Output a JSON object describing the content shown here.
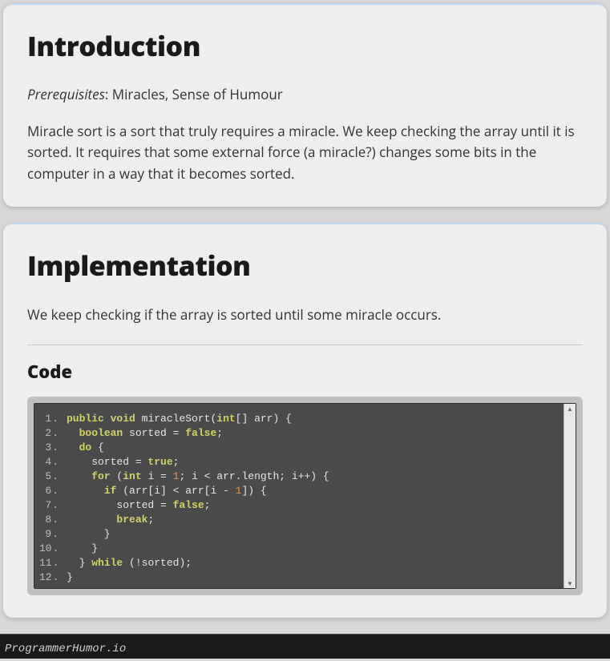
{
  "section1": {
    "heading": "Introduction",
    "prereq_label": "Prerequisites",
    "prereq_value": ": Miracles, Sense of Humour",
    "body": "Miracle sort is a sort that truly requires a miracle. We keep checking the array until it is sorted. It requires that some external force (a miracle?) changes some bits in the computer in a way that it becomes sorted."
  },
  "section2": {
    "heading": "Implementation",
    "body": "We keep checking if the array is sorted until some miracle occurs.",
    "code_heading": "Code",
    "code": [
      [
        {
          "t": "public",
          "c": "kw"
        },
        {
          "t": " "
        },
        {
          "t": "void",
          "c": "kw"
        },
        {
          "t": " miracleSort("
        },
        {
          "t": "int",
          "c": "type"
        },
        {
          "t": "[] arr) {"
        }
      ],
      [
        {
          "t": "  "
        },
        {
          "t": "boolean",
          "c": "type"
        },
        {
          "t": " sorted = "
        },
        {
          "t": "false",
          "c": "lit"
        },
        {
          "t": ";"
        }
      ],
      [
        {
          "t": "  "
        },
        {
          "t": "do",
          "c": "kw"
        },
        {
          "t": " {"
        }
      ],
      [
        {
          "t": "    sorted = "
        },
        {
          "t": "true",
          "c": "lit"
        },
        {
          "t": ";"
        }
      ],
      [
        {
          "t": "    "
        },
        {
          "t": "for",
          "c": "kw"
        },
        {
          "t": " ("
        },
        {
          "t": "int",
          "c": "type"
        },
        {
          "t": " i = "
        },
        {
          "t": "1",
          "c": "num"
        },
        {
          "t": "; i < arr.length; i++) {"
        }
      ],
      [
        {
          "t": "      "
        },
        {
          "t": "if",
          "c": "kw"
        },
        {
          "t": " (arr[i] < arr[i - "
        },
        {
          "t": "1",
          "c": "num"
        },
        {
          "t": "]) {"
        }
      ],
      [
        {
          "t": "        sorted = "
        },
        {
          "t": "false",
          "c": "lit"
        },
        {
          "t": ";"
        }
      ],
      [
        {
          "t": "        "
        },
        {
          "t": "break",
          "c": "kw"
        },
        {
          "t": ";"
        }
      ],
      [
        {
          "t": "      }"
        }
      ],
      [
        {
          "t": "    }"
        }
      ],
      [
        {
          "t": "  } "
        },
        {
          "t": "while",
          "c": "kw"
        },
        {
          "t": " (!sorted);"
        }
      ],
      [
        {
          "t": "}"
        }
      ]
    ]
  },
  "footer": {
    "watermark": "ProgrammerHumor.io"
  }
}
